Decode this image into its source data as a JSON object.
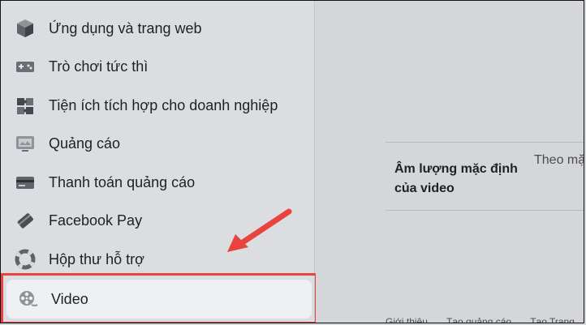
{
  "sidebar": {
    "items": [
      {
        "label": "Ứng dụng và trang web",
        "icon": "cube-icon"
      },
      {
        "label": "Trò chơi tức thì",
        "icon": "gamepad-icon"
      },
      {
        "label": "Tiện ích tích hợp cho doanh nghiệp",
        "icon": "puzzle-icon"
      },
      {
        "label": "Quảng cáo",
        "icon": "ad-monitor-icon"
      },
      {
        "label": "Thanh toán quảng cáo",
        "icon": "credit-card-icon"
      },
      {
        "label": "Facebook Pay",
        "icon": "pay-tag-icon"
      },
      {
        "label": "Hộp thư hỗ trợ",
        "icon": "lifebuoy-icon"
      }
    ],
    "selected": {
      "label": "Video",
      "icon": "film-reel-icon"
    }
  },
  "main": {
    "setting_label": "Âm lượng mặc định của video",
    "setting_value": "Theo mặ",
    "footer": [
      "Giới thiệu",
      "Tạo quảng cáo",
      "Tạo Trang"
    ]
  },
  "colors": {
    "highlight_border": "#e8433e",
    "arrow": "#e8433e"
  }
}
